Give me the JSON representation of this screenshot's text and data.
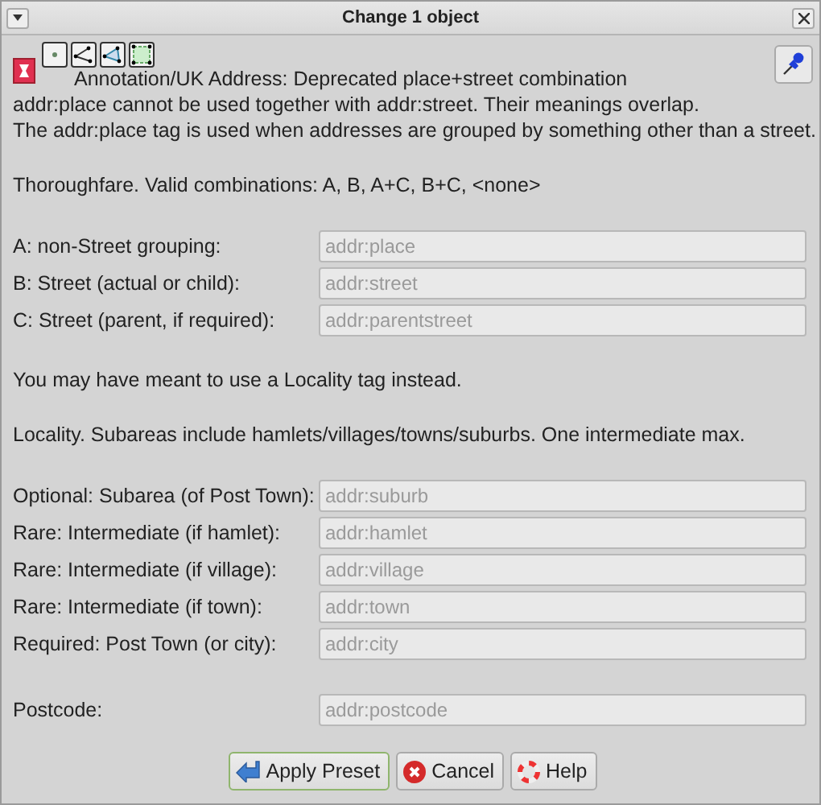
{
  "window": {
    "title": "Change 1 object"
  },
  "preset": {
    "title": "Annotation/UK Address: Deprecated place+street combination"
  },
  "rows": [
    {
      "kind": "text",
      "text": "addr:place cannot be used together with addr:street. Their meanings overlap."
    },
    {
      "kind": "text",
      "text": "The addr:place tag is used when addresses are grouped by something other than a street."
    },
    {
      "kind": "gap"
    },
    {
      "kind": "text",
      "text": "Thoroughfare. Valid combinations: A, B, A+C, B+C, <none>"
    },
    {
      "kind": "gap"
    },
    {
      "kind": "field",
      "label": "A: non-Street grouping:",
      "placeholder": "addr:place"
    },
    {
      "kind": "field",
      "label": "B: Street (actual or child):",
      "placeholder": "addr:street"
    },
    {
      "kind": "field",
      "label": "C: Street (parent, if required):",
      "placeholder": "addr:parentstreet"
    },
    {
      "kind": "gap"
    },
    {
      "kind": "text",
      "text": "You may have meant to use a Locality tag instead."
    },
    {
      "kind": "gap"
    },
    {
      "kind": "text",
      "text": "Locality. Subareas include hamlets/villages/towns/suburbs. One intermediate max."
    },
    {
      "kind": "gap"
    },
    {
      "kind": "field",
      "label": "Optional: Subarea (of Post Town):",
      "placeholder": "addr:suburb"
    },
    {
      "kind": "field",
      "label": "Rare: Intermediate (if hamlet):",
      "placeholder": "addr:hamlet"
    },
    {
      "kind": "field",
      "label": "Rare: Intermediate (if village):",
      "placeholder": "addr:village"
    },
    {
      "kind": "field",
      "label": "Rare: Intermediate (if town):",
      "placeholder": "addr:town"
    },
    {
      "kind": "field",
      "label": "Required: Post Town (or city):",
      "placeholder": "addr:city"
    },
    {
      "kind": "gap"
    },
    {
      "kind": "field",
      "label": "Postcode:",
      "placeholder": "addr:postcode"
    }
  ],
  "buttons": [
    {
      "label": "Apply Preset",
      "kind": "apply",
      "focused": true
    },
    {
      "label": "Cancel",
      "kind": "cancel",
      "focused": false
    },
    {
      "label": "Help",
      "kind": "help",
      "focused": false
    }
  ]
}
